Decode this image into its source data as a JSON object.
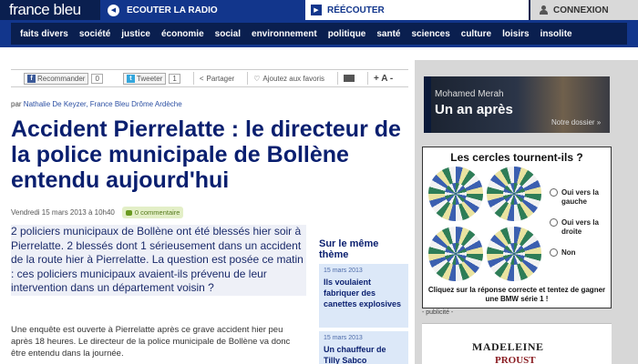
{
  "header": {
    "logo": "france bleu",
    "radio_label": "ECOUTER LA RADIO",
    "reecouter_label": "RÉÉCOUTER",
    "connexion_label": "CONNEXION"
  },
  "nav": {
    "items": [
      "faits divers",
      "société",
      "justice",
      "économie",
      "social",
      "environnement",
      "politique",
      "santé",
      "sciences",
      "culture",
      "loisirs",
      "insolite"
    ]
  },
  "share": {
    "facebook_label": "Recommander",
    "facebook_count": "0",
    "twitter_label": "Tweeter",
    "twitter_count": "1",
    "share_label": "Partager",
    "fav_label": "Ajoutez aux favoris",
    "font_size_label": "+ A -"
  },
  "article": {
    "byline_prefix": "par",
    "byline_author": "Nathalie De Keyzer, France Bleu Drôme Ardèche",
    "title": "Accident Pierrelatte : le directeur de la police municipale de Bollène entendu aujourd'hui",
    "date": "Vendredi 15 mars 2013 à 10h40",
    "comments": "0 commentaire",
    "lede": "2 policiers municipaux de Bollène ont été blessés hier soir à Pierrelatte. 2 blessés dont 1 sérieusement dans un accident de la route hier à Pierrelatte. La question est posée ce matin : ces policiers municipaux avaient-ils prévenu de leur intervention dans un département voisin ?",
    "body": "Une enquête est ouverte à Pierrelatte après ce grave accident hier peu après 18 heures. Le directeur de la police municipale de Bollène va donc être entendu dans la journée."
  },
  "related": {
    "title": "Sur le même thème",
    "items": [
      {
        "date": "15 mars 2013",
        "title": "Ils voulaient fabriquer des canettes explosives"
      },
      {
        "date": "15 mars 2013",
        "title": "Un chauffeur de Tilly Sabco"
      }
    ]
  },
  "ads": {
    "ad1_name": "Mohamed Merah",
    "ad1_title": "Un an après",
    "ad1_link": "Notre dossier »",
    "ad2_title": "Les cercles tournent-ils ?",
    "ad2_options": [
      "Oui vers la gauche",
      "Oui vers la droite",
      "Non"
    ],
    "ad2_footer": "Cliquez sur la réponse correcte et tentez de gagner une BMW série 1 !",
    "publicite": "- publicité -",
    "ad3_line1": "MADELEINE",
    "ad3_line2": "PROUST"
  }
}
